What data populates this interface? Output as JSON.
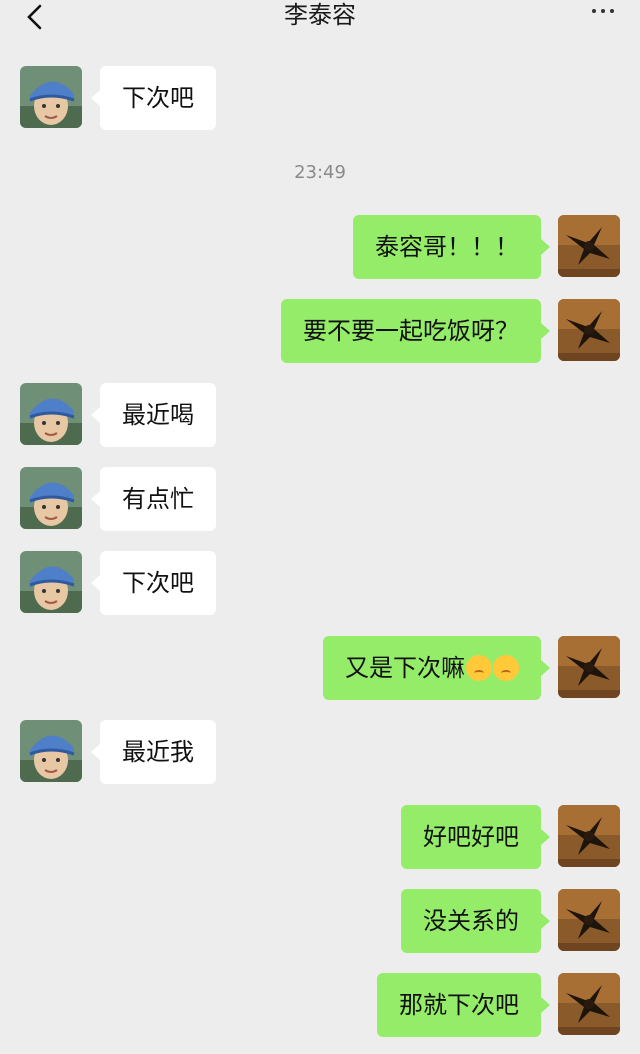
{
  "header": {
    "title": "李泰容",
    "back_icon": "chevron-left-icon",
    "more_icon": "more-dots-icon"
  },
  "timestamp": "23:49",
  "colors": {
    "background": "#ededed",
    "incoming_bubble": "#ffffff",
    "outgoing_bubble": "#95ec69"
  },
  "messages": [
    {
      "side": "in",
      "text": "下次吧"
    },
    {
      "side": "out",
      "text": "泰容哥！！！"
    },
    {
      "side": "out",
      "text": "要不要一起吃饭呀？"
    },
    {
      "side": "in",
      "text": "最近喝"
    },
    {
      "side": "in",
      "text": "有点忙"
    },
    {
      "side": "in",
      "text": "下次吧"
    },
    {
      "side": "out",
      "text": "又是下次嘛",
      "emojis": [
        "sad-face-emoji",
        "pouting-face-emoji"
      ]
    },
    {
      "side": "in",
      "text": "最近我"
    },
    {
      "side": "out",
      "text": "好吧好吧"
    },
    {
      "side": "out",
      "text": "没关系的"
    },
    {
      "side": "out",
      "text": "那就下次吧"
    }
  ]
}
